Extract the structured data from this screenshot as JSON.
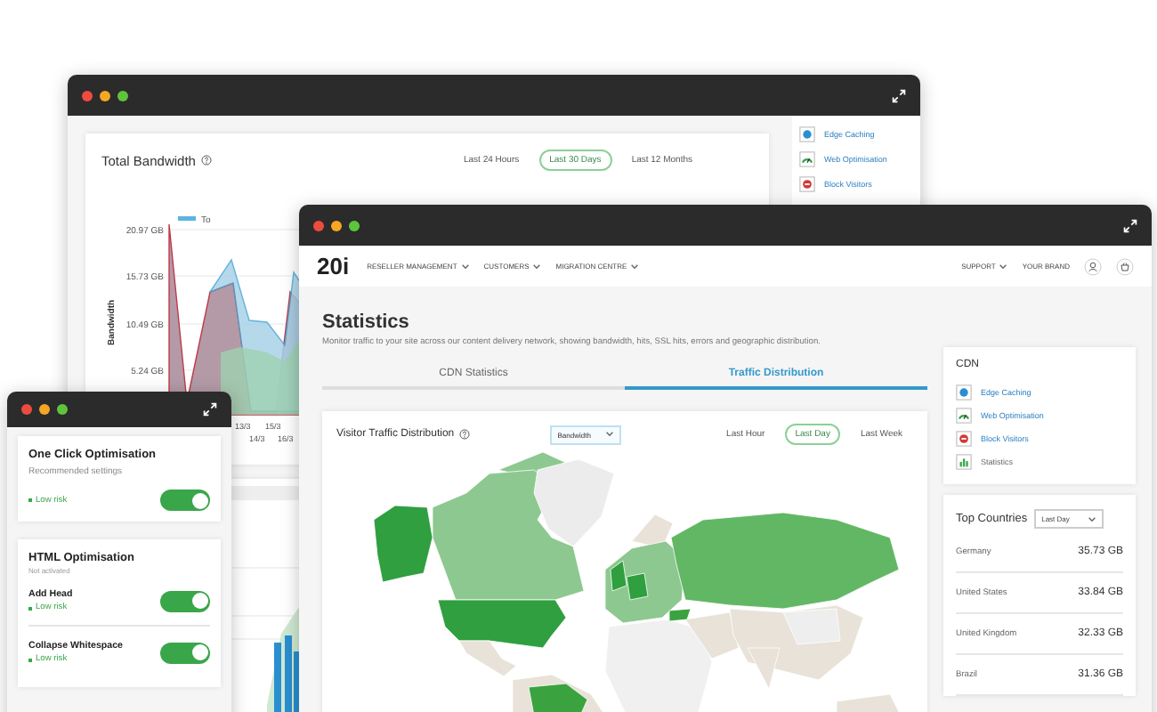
{
  "back_window": {
    "bandwidth": {
      "title": "Total Bandwidth",
      "ranges": [
        {
          "label": "Last 24 Hours",
          "selected": false
        },
        {
          "label": "Last 30 Days",
          "selected": true
        },
        {
          "label": "Last 12 Months",
          "selected": false
        }
      ],
      "legend": "To",
      "y_axis_title": "Bandwidth",
      "y_labels": [
        "20.97 GB",
        "15.73 GB",
        "10.49 GB",
        "5.24 GB"
      ],
      "x_labels": [
        "13/3",
        "15/3",
        "14/3",
        "16/3"
      ]
    },
    "cdn_items": [
      {
        "label": "Edge Caching",
        "kind": "edge"
      },
      {
        "label": "Web Optimisation",
        "kind": "speed"
      },
      {
        "label": "Block Visitors",
        "kind": "block"
      }
    ]
  },
  "main_window": {
    "logo": "20i",
    "nav": [
      {
        "label": "RESELLER MANAGEMENT",
        "kind": "menu"
      },
      {
        "label": "CUSTOMERS",
        "kind": "menu"
      },
      {
        "label": "MIGRATION CENTRE",
        "kind": "menu"
      }
    ],
    "nav_right": [
      {
        "label": "SUPPORT",
        "kind": "menu"
      },
      {
        "label": "YOUR BRAND",
        "kind": "link"
      }
    ],
    "title": "Statistics",
    "description": "Monitor traffic to your site across our content delivery network, showing bandwidth, hits, SSL hits, errors and geographic distribution.",
    "tabs": [
      {
        "label": "CDN Statistics",
        "selected": false
      },
      {
        "label": "Traffic Distribution",
        "selected": true
      }
    ],
    "traffic_card": {
      "title": "Visitor Traffic Distribution",
      "metric": "Bandwidth",
      "ranges": [
        {
          "label": "Last Hour",
          "selected": false
        },
        {
          "label": "Last Day",
          "selected": true
        },
        {
          "label": "Last Week",
          "selected": false
        }
      ]
    },
    "cdn": {
      "title": "CDN",
      "items": [
        {
          "label": "Edge Caching",
          "kind": "edge",
          "link": true
        },
        {
          "label": "Web Optimisation",
          "kind": "speed",
          "link": true
        },
        {
          "label": "Block Visitors",
          "kind": "block",
          "link": true
        },
        {
          "label": "Statistics",
          "kind": "stats",
          "link": false
        }
      ]
    },
    "top_countries": {
      "title": "Top Countries",
      "period": "Last Day",
      "rows": [
        {
          "country": "Germany",
          "value": "35.73 GB"
        },
        {
          "country": "United States",
          "value": "33.84 GB"
        },
        {
          "country": "United Kingdom",
          "value": "32.33 GB"
        },
        {
          "country": "Brazil",
          "value": "31.36 GB"
        }
      ]
    }
  },
  "left_window": {
    "one_click": {
      "title": "One Click Optimisation",
      "subtitle": "Recommended settings",
      "risk": "Low risk",
      "on": true
    },
    "html": {
      "title": "HTML Optimisation",
      "subtitle": "Not activated",
      "rows": [
        {
          "label": "Add Head",
          "risk": "Low risk",
          "on": true
        },
        {
          "label": "Collapse Whitespace",
          "risk": "Low risk",
          "on": true
        }
      ]
    }
  }
}
